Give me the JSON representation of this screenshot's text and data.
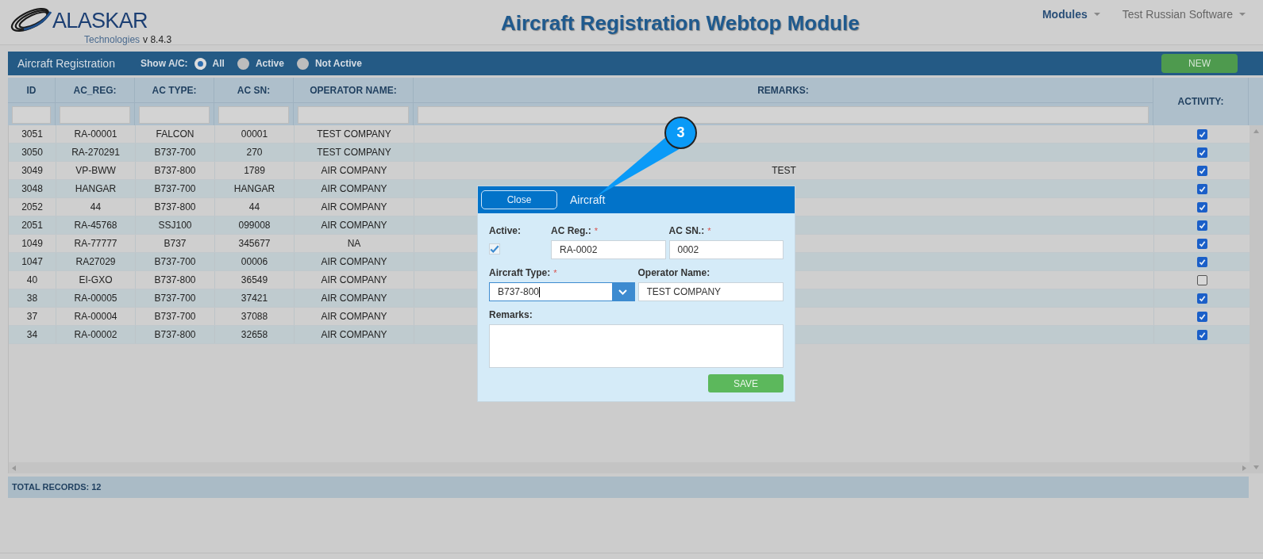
{
  "header": {
    "logo": {
      "name": "ALASKAR",
      "subtitle": "Technologies",
      "version": "v 8.4.3"
    },
    "title": "Aircraft Registration Webtop Module",
    "nav": [
      {
        "label": "Modules",
        "active": true
      },
      {
        "label": "Test Russian Software",
        "active": false
      }
    ]
  },
  "toolbar": {
    "title": "Aircraft Registration",
    "filter_label": "Show A/C:",
    "filter_options": [
      {
        "label": "All",
        "selected": true
      },
      {
        "label": "Active",
        "selected": false
      },
      {
        "label": "Not Active",
        "selected": false
      }
    ],
    "new_button": "NEW"
  },
  "table": {
    "columns": [
      {
        "label": "ID",
        "filterable": true
      },
      {
        "label": "AC_REG:",
        "filterable": true
      },
      {
        "label": "AC TYPE:",
        "filterable": true
      },
      {
        "label": "AC SN:",
        "filterable": true
      },
      {
        "label": "OPERATOR NAME:",
        "filterable": true
      },
      {
        "label": "REMARKS:",
        "filterable": true
      },
      {
        "label": "ACTIVITY:",
        "filterable": false
      }
    ],
    "rows": [
      {
        "id": "3051",
        "ac_reg": "RA-00001",
        "ac_type": "FALCON",
        "ac_sn": "00001",
        "operator": "TEST COMPANY",
        "active": true
      },
      {
        "id": "3050",
        "ac_reg": "RA-270291",
        "ac_type": "B737-700",
        "ac_sn": "270",
        "operator": "TEST COMPANY",
        "active": true
      },
      {
        "id": "3049",
        "ac_reg": "VP-BWW",
        "ac_type": "B737-800",
        "ac_sn": "1789",
        "operator": "AIR COMPANY",
        "remarks": "TEST",
        "active": true
      },
      {
        "id": "3048",
        "ac_reg": "HANGAR",
        "ac_type": "B737-700",
        "ac_sn": "HANGAR",
        "operator": "AIR COMPANY",
        "active": true
      },
      {
        "id": "2052",
        "ac_reg": "44",
        "ac_type": "B737-800",
        "ac_sn": "44",
        "operator": "AIR COMPANY",
        "active": true
      },
      {
        "id": "2051",
        "ac_reg": "RA-45768",
        "ac_type": "SSJ100",
        "ac_sn": "099008",
        "operator": "AIR COMPANY",
        "active": true
      },
      {
        "id": "1049",
        "ac_reg": "RA-77777",
        "ac_type": "B737",
        "ac_sn": "345677",
        "operator": "NA",
        "active": true
      },
      {
        "id": "1047",
        "ac_reg": "RA27029",
        "ac_type": "B737-700",
        "ac_sn": "00006",
        "operator": "AIR COMPANY",
        "active": true
      },
      {
        "id": "40",
        "ac_reg": "EI-GXO",
        "ac_type": "B737-800",
        "ac_sn": "36549",
        "operator": "AIR COMPANY",
        "active": false
      },
      {
        "id": "38",
        "ac_reg": "RA-00005",
        "ac_type": "B737-700",
        "ac_sn": "37421",
        "operator": "AIR COMPANY",
        "active": true
      },
      {
        "id": "37",
        "ac_reg": "RA-00004",
        "ac_type": "B737-700",
        "ac_sn": "37088",
        "operator": "AIR COMPANY",
        "active": true
      },
      {
        "id": "34",
        "ac_reg": "RA-00002",
        "ac_type": "B737-800",
        "ac_sn": "32658",
        "operator": "AIR COMPANY",
        "active": true
      }
    ],
    "total": "TOTAL RECORDS: 12"
  },
  "dialog": {
    "close_button": "Close",
    "title": "Aircraft",
    "callout": "3",
    "field_rows": [
      [
        {
          "kind": "checkbox",
          "label": "Active:",
          "checked": true
        },
        {
          "kind": "text",
          "label": "AC Reg.:",
          "required_mark": "*",
          "value": "RA-0002"
        },
        {
          "kind": "text",
          "label": "AC SN.:",
          "required_mark": "*",
          "value": "0002"
        }
      ],
      [
        {
          "kind": "select",
          "label": "Aircraft Type:",
          "required_mark": "*",
          "value": "B737-800"
        },
        {
          "kind": "text",
          "label": "Operator Name:",
          "value": "TEST COMPANY"
        }
      ],
      [
        {
          "kind": "textarea",
          "label": "Remarks:"
        }
      ]
    ],
    "save_button": "SAVE"
  }
}
